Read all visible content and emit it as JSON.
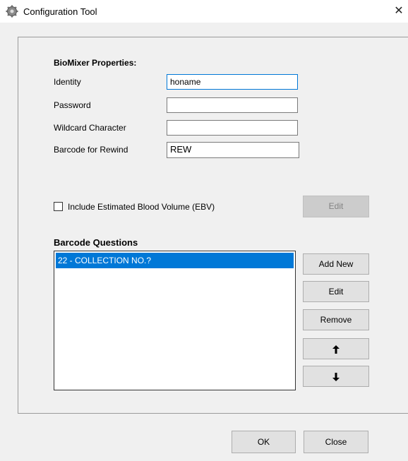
{
  "window": {
    "title": "Configuration Tool",
    "close_glyph": "✕"
  },
  "properties": {
    "heading": "BioMixer Properties:",
    "identity_label": "Identity",
    "identity_value": "honame",
    "password_label": "Password",
    "password_value": "",
    "wildcard_label": "Wildcard Character",
    "wildcard_value": "",
    "rewind_label": "Barcode for Rewind",
    "rewind_value": "REW"
  },
  "ebv": {
    "checkbox_label": "Include Estimated Blood Volume (EBV)",
    "checked": false,
    "edit_label": "Edit"
  },
  "questions": {
    "heading": "Barcode Questions",
    "items": [
      "22 - COLLECTION NO.?"
    ],
    "add_label": "Add New",
    "edit_label": "Edit",
    "remove_label": "Remove",
    "up_glyph": "🡑",
    "down_glyph": "🡓"
  },
  "footer": {
    "ok_label": "OK",
    "close_label": "Close"
  },
  "colors": {
    "selection": "#0078d7",
    "focus_border": "#0078d7",
    "button_face": "#e1e1e1",
    "disabled_button": "#cccccc"
  },
  "icons": {
    "window_icon": "gear-icon",
    "close": "close-icon",
    "move_up": "arrow-up-icon",
    "move_down": "arrow-down-icon"
  }
}
